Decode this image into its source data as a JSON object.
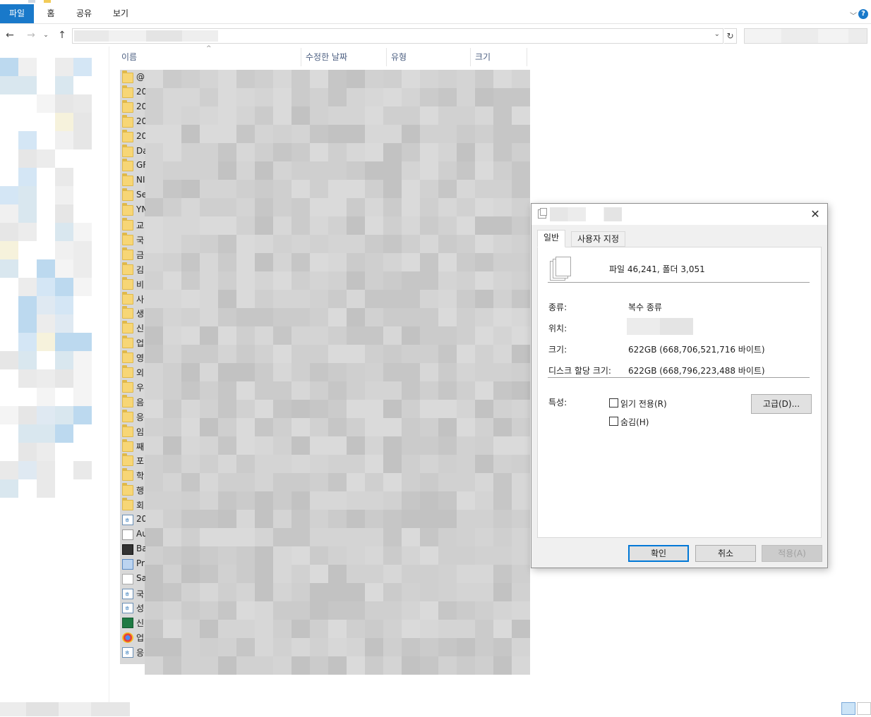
{
  "ribbon": {
    "tabs": [
      {
        "id": "file",
        "label": "파일"
      },
      {
        "id": "home",
        "label": "홈"
      },
      {
        "id": "share",
        "label": "공유"
      },
      {
        "id": "view",
        "label": "보기"
      }
    ],
    "collapse_icon": "chevron-down-icon",
    "help_label": "?"
  },
  "nav": {
    "back_icon": "arrow-left-icon",
    "forward_icon": "arrow-right-icon",
    "recent_icon": "chevron-down-icon",
    "up_icon": "arrow-up-icon",
    "address_dropdown_icon": "chevron-down-icon",
    "refresh_icon": "refresh-icon"
  },
  "columns": {
    "name": "이름",
    "modified": "수정한 날짜",
    "type": "유형",
    "size": "크기"
  },
  "files": [
    {
      "icon": "folder",
      "name": "@"
    },
    {
      "icon": "folder",
      "name": "20"
    },
    {
      "icon": "folder",
      "name": "20"
    },
    {
      "icon": "folder",
      "name": "20"
    },
    {
      "icon": "folder",
      "name": "20"
    },
    {
      "icon": "folder",
      "name": "Da"
    },
    {
      "icon": "folder",
      "name": "GF"
    },
    {
      "icon": "folder",
      "name": "NI"
    },
    {
      "icon": "folder",
      "name": "Se"
    },
    {
      "icon": "folder",
      "name": "YN"
    },
    {
      "icon": "folder",
      "name": "교"
    },
    {
      "icon": "folder",
      "name": "국"
    },
    {
      "icon": "folder",
      "name": "금"
    },
    {
      "icon": "folder",
      "name": "김"
    },
    {
      "icon": "folder",
      "name": "비"
    },
    {
      "icon": "folder",
      "name": "사"
    },
    {
      "icon": "folder",
      "name": "생"
    },
    {
      "icon": "folder",
      "name": "신"
    },
    {
      "icon": "folder",
      "name": "업"
    },
    {
      "icon": "folder",
      "name": "영"
    },
    {
      "icon": "folder",
      "name": "외"
    },
    {
      "icon": "folder",
      "name": "우"
    },
    {
      "icon": "folder",
      "name": "음"
    },
    {
      "icon": "folder",
      "name": "응"
    },
    {
      "icon": "folder",
      "name": "임"
    },
    {
      "icon": "folder",
      "name": "째"
    },
    {
      "icon": "folder",
      "name": "포"
    },
    {
      "icon": "folder",
      "name": "학"
    },
    {
      "icon": "folder",
      "name": "행"
    },
    {
      "icon": "folder",
      "name": "회"
    },
    {
      "icon": "doc",
      "name": "20"
    },
    {
      "icon": "gen",
      "name": "Au"
    },
    {
      "icon": "dark",
      "name": "Ba"
    },
    {
      "icon": "prog",
      "name": "Pr"
    },
    {
      "icon": "txt",
      "name": "Sa"
    },
    {
      "icon": "doc",
      "name": "국"
    },
    {
      "icon": "doc",
      "name": "성"
    },
    {
      "icon": "xl",
      "name": "신"
    },
    {
      "icon": "chrome",
      "name": "업"
    },
    {
      "icon": "doc",
      "name": "응"
    }
  ],
  "dialog": {
    "close_label": "✕",
    "tabs": [
      "일반",
      "사용자 지정"
    ],
    "summary": "파일 46,241, 폴더 3,051",
    "type_label": "종류:",
    "type_value": "복수 종류",
    "location_label": "위치:",
    "size_label": "크기:",
    "size_value": "622GB (668,706,521,716 바이트)",
    "disk_size_label": "디스크 할당 크기:",
    "disk_size_value": "622GB (668,796,223,488 바이트)",
    "attributes_label": "특성:",
    "readonly_label": "읽기 전용(R)",
    "hidden_label": "숨김(H)",
    "advanced_label": "고급(D)...",
    "ok_label": "확인",
    "cancel_label": "취소",
    "apply_label": "적용(A)"
  }
}
